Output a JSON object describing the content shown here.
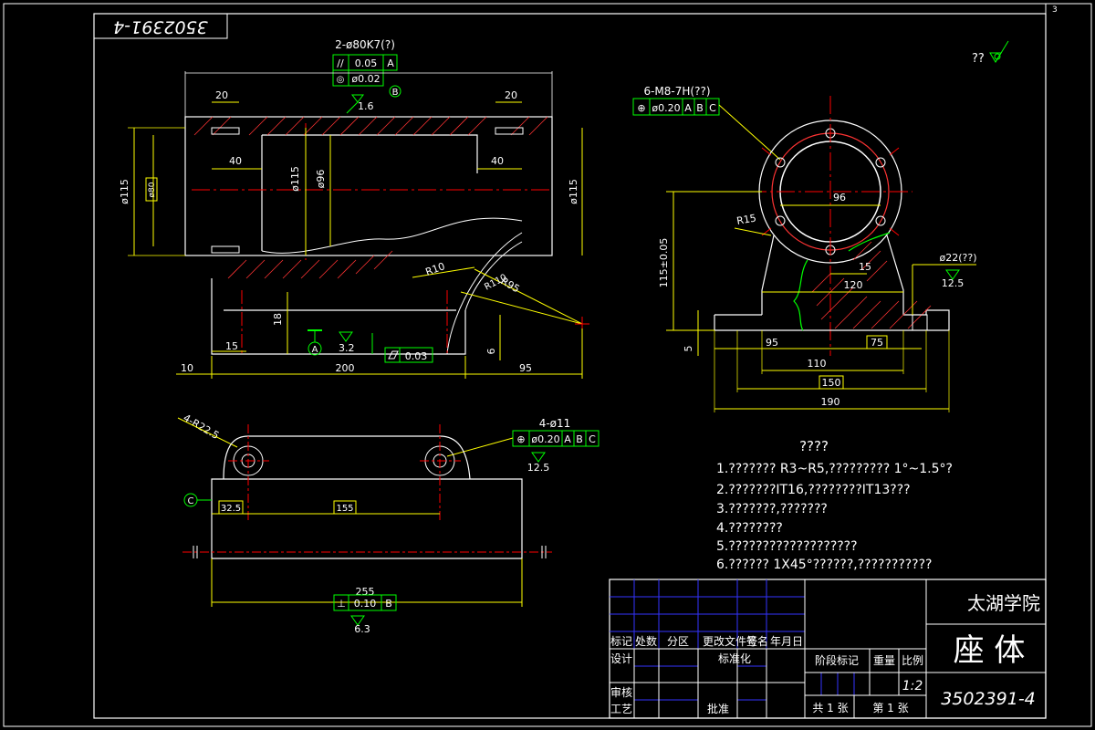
{
  "drawing_number": "3502391-4",
  "sheet_marker": "3",
  "school": "太湖学院",
  "part_name": "座 体",
  "scale": "1:2",
  "roughness_note": "??",
  "front_view": {
    "bore_label": "2-ø80K7(?)",
    "tol1_sym": "//",
    "tol1_val": "0.05",
    "tol1_ref": "A",
    "tol2_sym": "◎",
    "tol2_val": "ø0.02",
    "tol2_ref": "B",
    "datum_b": "B",
    "rough_1_6": "1.6",
    "dim_20a": "20",
    "dim_20b": "20",
    "dim_40a": "40",
    "dim_40b": "40",
    "dim_115a": "ø115",
    "dim_115b": "ø115",
    "dim_115c": "ø115",
    "dim_96": "ø96",
    "dim_boxed": "ø80",
    "dim_r10": "R10",
    "dim_r95": "R95",
    "dim_r110": "R110",
    "dim_18": "18",
    "dim_15": "15",
    "dim_6": "6",
    "datum_a": "A",
    "rough_3_2": "3.2",
    "flat_val": "0.03",
    "dim_10": "10",
    "dim_200": "200",
    "dim_95": "95"
  },
  "side_view": {
    "thread_label": "6-M8-7H(??)",
    "tol_val": "ø0.20",
    "ref_a": "A",
    "ref_b": "B",
    "ref_c": "C",
    "dim_96": "96",
    "dim_r15": "R15",
    "dim_115": "115±0.05",
    "dim_15": "15",
    "dim_120": "120",
    "dim_22": "ø22(??)",
    "rough_12_5": "12.5",
    "dim_5": "5",
    "dim_95": "95",
    "dim_75": "75",
    "dim_110": "110",
    "dim_150": "150",
    "dim_190": "190"
  },
  "top_view": {
    "r_label": "4-R22.5",
    "hole_label": "4-ø11",
    "tol_val": "ø0.20",
    "ref_a": "A",
    "ref_b": "B",
    "ref_c": "C",
    "rough_12_5": "12.5",
    "datum_c": "C",
    "dim_32_5": "32.5",
    "dim_155": "155",
    "dim_255": "255",
    "perp_val": "0.10",
    "perp_ref": "B",
    "rough_6_3": "6.3"
  },
  "notes": {
    "title": "????",
    "items": [
      "1.???????  R3~R5,?????????  1°~1.5°?",
      "2.???????IT16,????????IT13???",
      "3.???????,???????",
      "4.????????",
      "5.???????????????????",
      "6.??????  1X45°??????,???????????"
    ]
  },
  "title_block": {
    "h_biaoji": "标记",
    "h_chushu": "处数",
    "h_fenqu": "分区",
    "h_genggai": "更改文件号",
    "h_qianming": "签名",
    "h_nianyueri": "年月日",
    "h_sheji": "设计",
    "h_biaozhunhua": "标准化",
    "h_jieduan": "阶段标记",
    "h_zhongliang": "重量",
    "h_bili": "比例",
    "h_shenhe": "审核",
    "h_gongyi": "工艺",
    "h_pizhun": "批准",
    "h_gong": "共 1 张",
    "h_di": "第 1 张"
  }
}
